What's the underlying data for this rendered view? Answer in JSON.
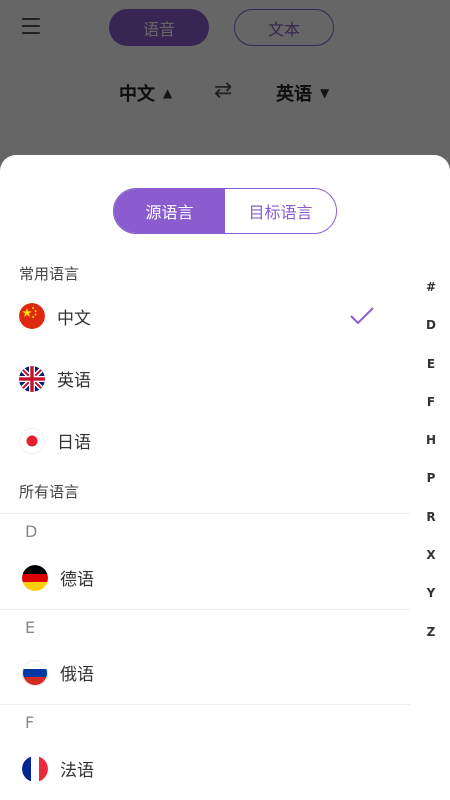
{
  "background": {
    "mode_voice": "语音",
    "mode_text": "文本",
    "source_lang": "中文",
    "target_lang": "英语"
  },
  "sheet": {
    "tabs": [
      {
        "label": "源语言",
        "active": true
      },
      {
        "label": "目标语言",
        "active": false
      }
    ],
    "common_title": "常用语言",
    "common": [
      {
        "name": "中文",
        "flag": "china-flag-icon",
        "selected": true
      },
      {
        "name": "英语",
        "flag": "uk-flag-icon",
        "selected": false
      },
      {
        "name": "日语",
        "flag": "japan-flag-icon",
        "selected": false
      }
    ],
    "all_title": "所有语言",
    "groups": [
      {
        "letter": "D",
        "items": [
          {
            "name": "德语",
            "flag": "germany-flag-icon"
          }
        ]
      },
      {
        "letter": "E",
        "items": [
          {
            "name": "俄语",
            "flag": "russia-flag-icon"
          }
        ]
      },
      {
        "letter": "F",
        "items": [
          {
            "name": "法语",
            "flag": "france-flag-icon"
          }
        ]
      }
    ],
    "index": [
      "#",
      "D",
      "E",
      "F",
      "H",
      "P",
      "R",
      "X",
      "Y",
      "Z"
    ]
  },
  "colors": {
    "accent": "#8a5cd0"
  }
}
